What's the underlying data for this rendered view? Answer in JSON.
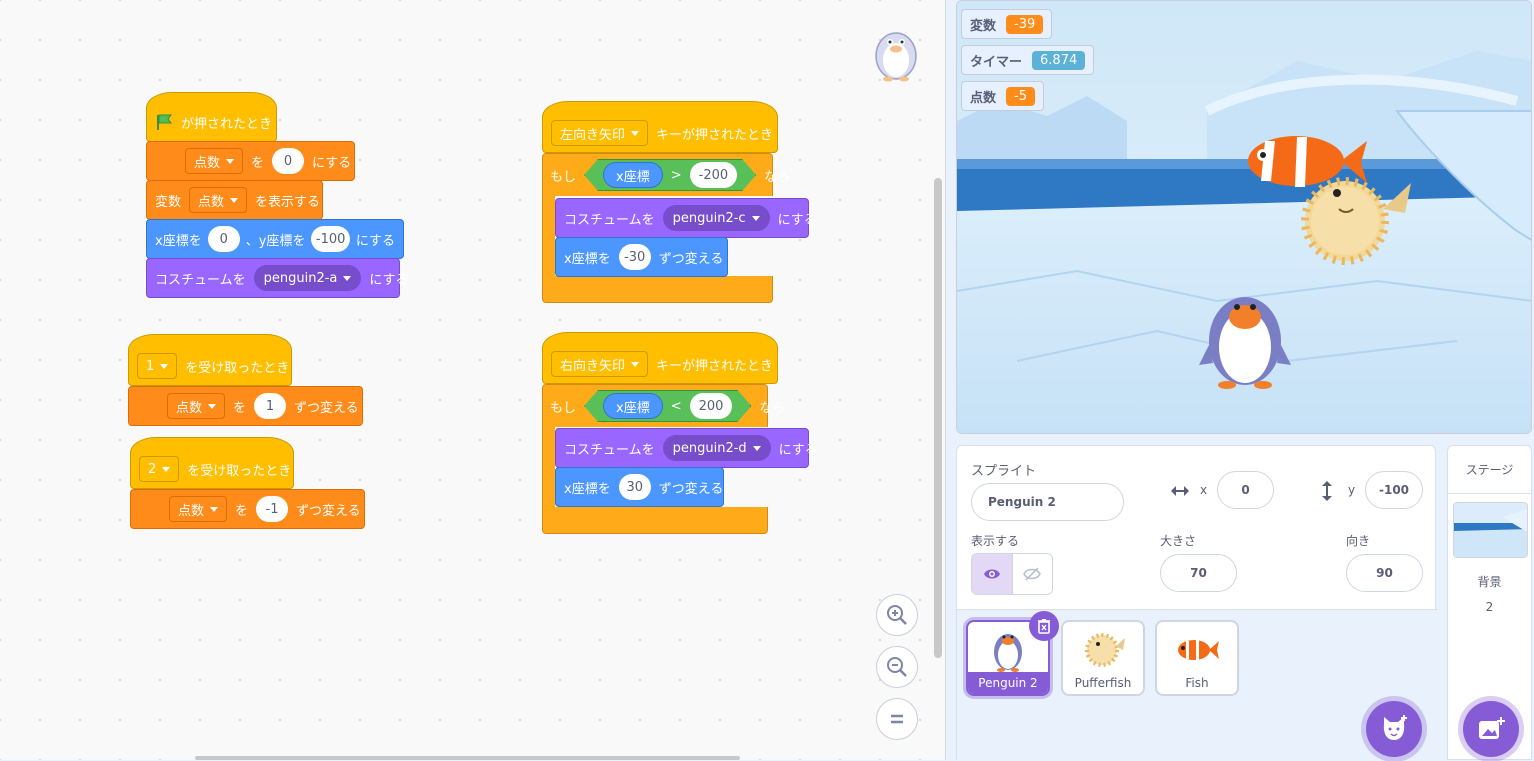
{
  "scripts": {
    "flag_hat": "が押されたとき",
    "s1_set_var": "点数",
    "s1_set_wo": "を",
    "s1_set_val": "0",
    "s1_set_suffix": "にする",
    "s1_show_prefix": "変数",
    "s1_show_var": "点数",
    "s1_show_suffix": "を表示する",
    "s1_goto_x_label": "x座標を",
    "s1_goto_x": "0",
    "s1_goto_y_label": "、y座標を",
    "s1_goto_y": "-100",
    "s1_goto_suffix": "にする",
    "s1_costume_label": "コスチュームを",
    "s1_costume": "penguin2-a",
    "s1_costume_suffix": "にする",
    "s2_msg": "1",
    "s2_hat": "を受け取ったとき",
    "s2_var": "点数",
    "s2_wo": "を",
    "s2_val": "1",
    "s2_suffix": "ずつ変える",
    "s3_msg": "2",
    "s3_hat": "を受け取ったとき",
    "s3_var": "点数",
    "s3_wo": "を",
    "s3_val": "-1",
    "s3_suffix": "ずつ変える",
    "s4_key": "左向き矢印",
    "s4_hat": "キーが押されたとき",
    "s4_if": "もし",
    "s4_rep": "x座標",
    "s4_op": ">",
    "s4_cmp": "-200",
    "s4_then": "なら",
    "s4_costume_label": "コスチュームを",
    "s4_costume": "penguin2-c",
    "s4_costume_suffix": "にする",
    "s4_change_label": "x座標を",
    "s4_change_val": "-30",
    "s4_change_suffix": "ずつ変える",
    "s5_key": "右向き矢印",
    "s5_hat": "キーが押されたとき",
    "s5_if": "もし",
    "s5_rep": "x座標",
    "s5_op": "<",
    "s5_cmp": "200",
    "s5_then": "なら",
    "s5_costume_label": "コスチュームを",
    "s5_costume": "penguin2-d",
    "s5_costume_suffix": "にする",
    "s5_change_label": "x座標を",
    "s5_change_val": "30",
    "s5_change_suffix": "ずつ変える"
  },
  "monitors": [
    {
      "label": "変数",
      "value": "-39",
      "color": "#ff8c1a"
    },
    {
      "label": "タイマー",
      "value": "6.874",
      "color": "#5cb1d6"
    },
    {
      "label": "点数",
      "value": "-5",
      "color": "#ff8c1a"
    }
  ],
  "sprite_info": {
    "title": "スプライト",
    "name": "Penguin 2",
    "x_label": "x",
    "x": "0",
    "y_label": "y",
    "y": "-100",
    "show_label": "表示する",
    "size_label": "大きさ",
    "size": "70",
    "direction_label": "向き",
    "direction": "90"
  },
  "sprites": [
    {
      "name": "Penguin 2",
      "icon": "penguin-icon",
      "selected": true
    },
    {
      "name": "Pufferfish",
      "icon": "pufferfish-icon",
      "selected": false
    },
    {
      "name": "Fish",
      "icon": "fish-icon",
      "selected": false
    }
  ],
  "stage_panel": {
    "title": "ステージ",
    "backdrops_label": "背景",
    "backdrops_count": "2"
  },
  "colors": {
    "events": "#ffbf00",
    "variables": "#ff8c1a",
    "motion": "#4c97ff",
    "looks": "#9966ff",
    "control": "#ffab19",
    "operators": "#59c059",
    "accent": "#855cd6"
  }
}
